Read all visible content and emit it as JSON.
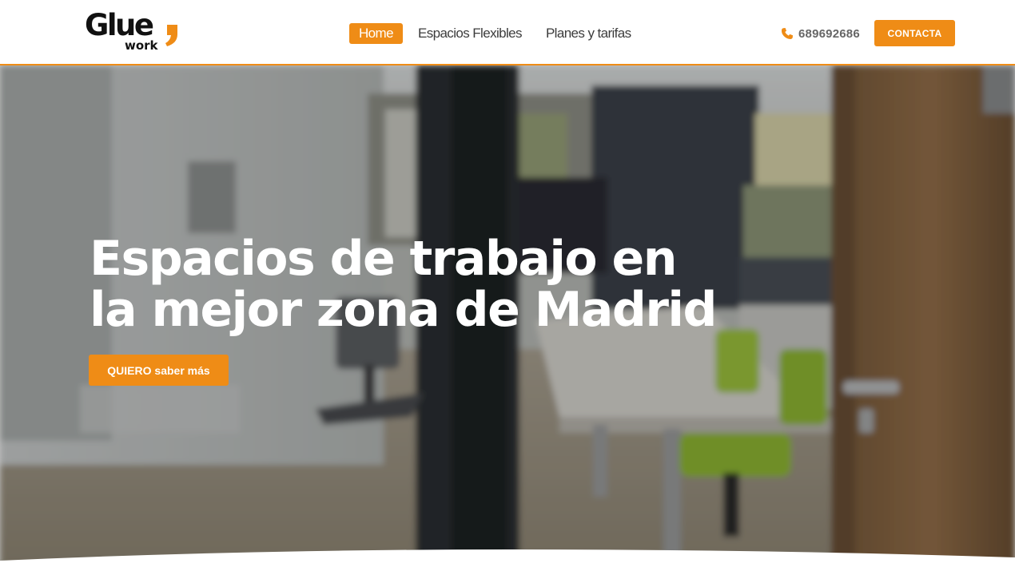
{
  "brand": {
    "name": "Glue",
    "sub": "work",
    "accent_color": "#ef8c16"
  },
  "nav": {
    "items": [
      {
        "label": "Home",
        "active": true
      },
      {
        "label": "Espacios Flexibles",
        "active": false
      },
      {
        "label": "Planes y tarifas",
        "active": false
      }
    ]
  },
  "header": {
    "phone": "689692686",
    "phone_icon": "phone-icon",
    "contact_label": "CONTACTA"
  },
  "hero": {
    "title_line1": "Espacios de trabajo en",
    "title_line2_prefix": "la mejor zona de ",
    "title_line2_bold": "Madrid",
    "cta_label": "QUIERO saber más",
    "background": "office-photo-blurred"
  }
}
